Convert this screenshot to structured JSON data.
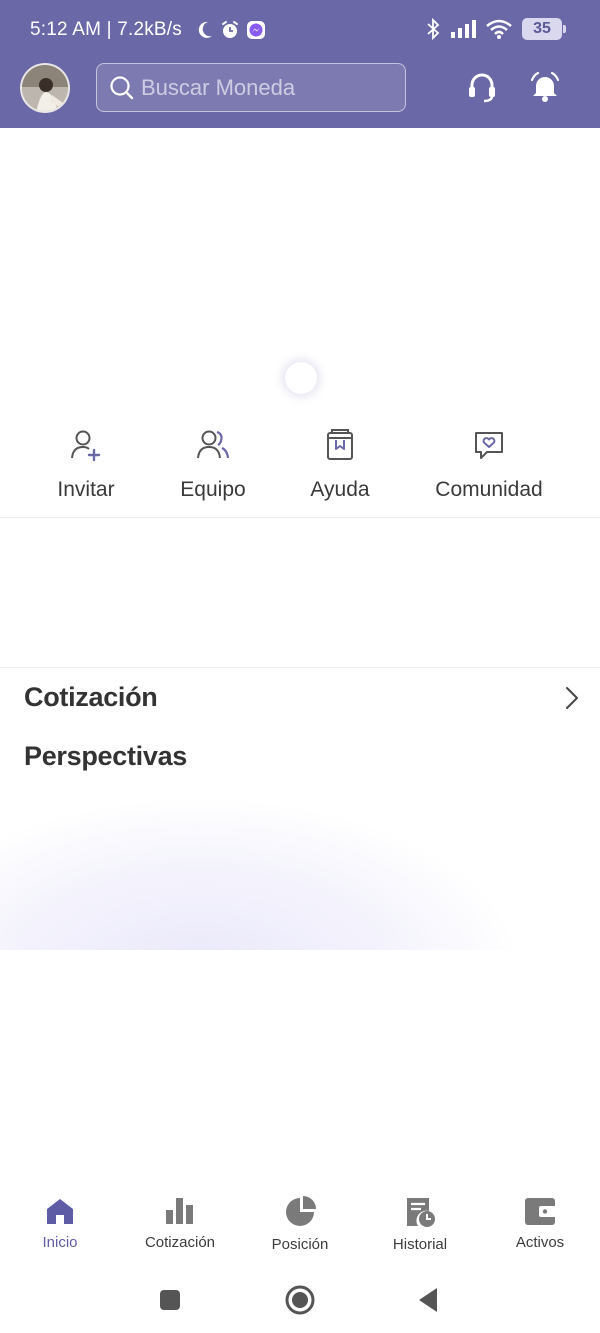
{
  "status_bar": {
    "time": "5:12 AM | 7.2kB/s",
    "battery": "35"
  },
  "header": {
    "search_placeholder": "Buscar Moneda"
  },
  "quick_actions": [
    {
      "label": "Invitar",
      "icon": "user-plus-icon"
    },
    {
      "label": "Equipo",
      "icon": "team-icon"
    },
    {
      "label": "Ayuda",
      "icon": "book-icon"
    },
    {
      "label": "Comunidad",
      "icon": "chat-heart-icon"
    }
  ],
  "sections": {
    "quotes_title": "Cotización",
    "outlook_title": "Perspectivas"
  },
  "tabbar": [
    {
      "label": "Inicio",
      "icon": "home-icon",
      "active": true
    },
    {
      "label": "Cotización",
      "icon": "bar-chart-icon",
      "active": false
    },
    {
      "label": "Posición",
      "icon": "pie-chart-icon",
      "active": false
    },
    {
      "label": "Historial",
      "icon": "history-icon",
      "active": false
    },
    {
      "label": "Activos",
      "icon": "wallet-icon",
      "active": false
    }
  ],
  "colors": {
    "brand": "#6b68a8",
    "active_tab": "#5f5ca6",
    "icon_gray": "#7a7a7a"
  }
}
